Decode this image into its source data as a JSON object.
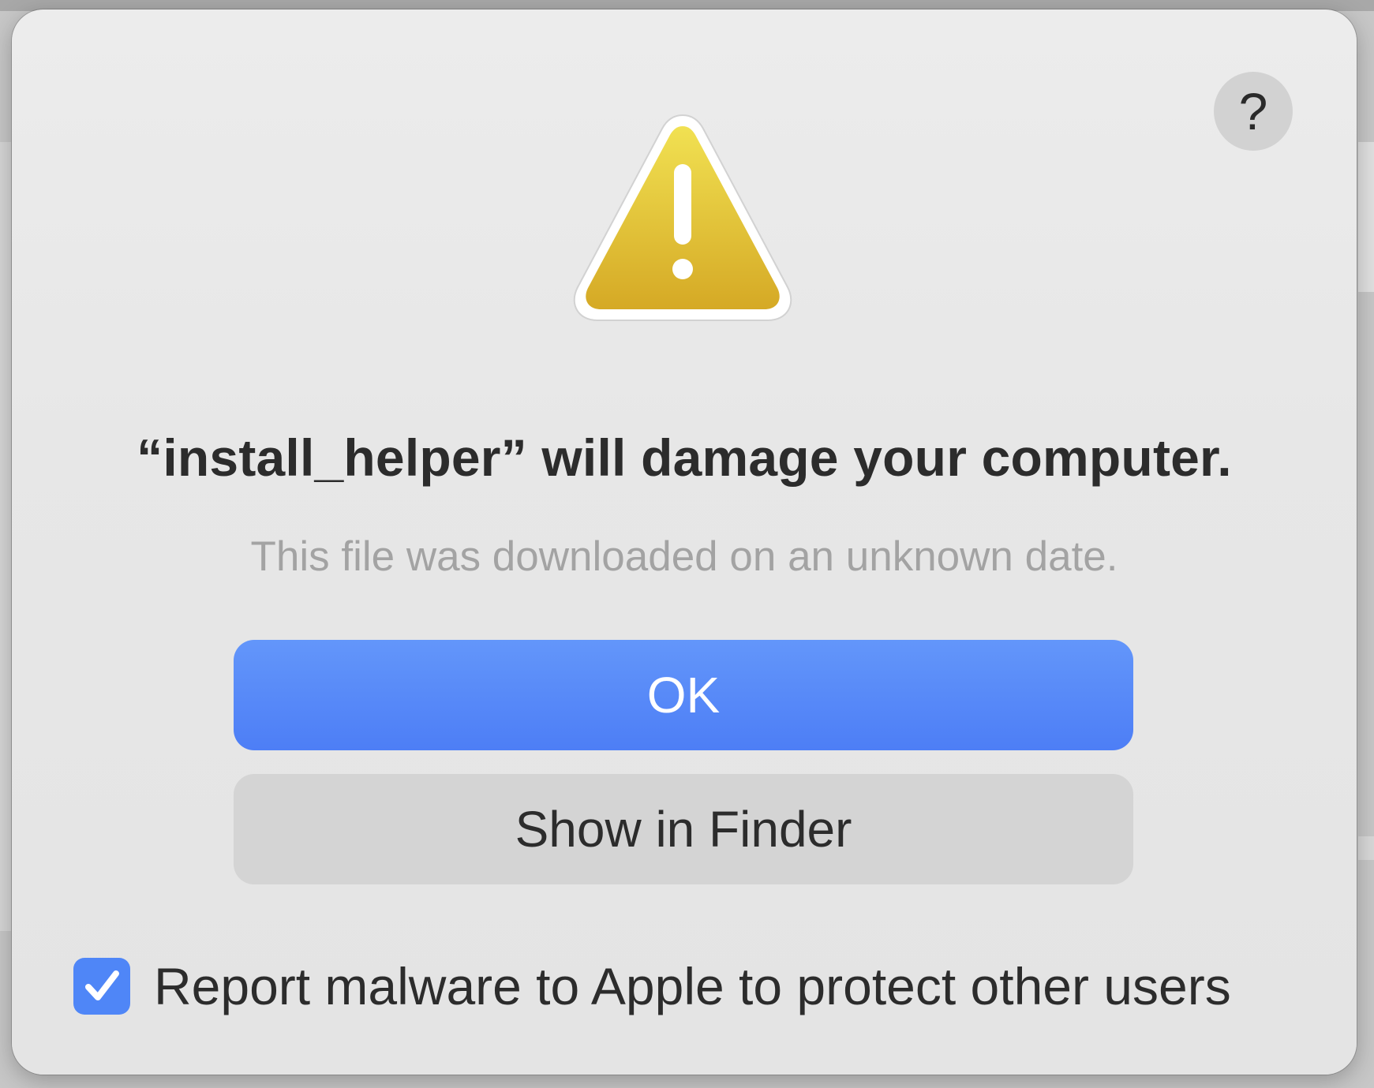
{
  "dialog": {
    "help_label": "?",
    "icon": "warning-triangle-icon",
    "title": "“install_helper” will damage your computer.",
    "subtitle": "This file was downloaded on an unknown date.",
    "buttons": {
      "ok_label": "OK",
      "show_in_finder_label": "Show in Finder"
    },
    "report": {
      "checked": true,
      "label": "Report malware to Apple to protect other users"
    }
  },
  "colors": {
    "primary_button": "#5a8cf8",
    "secondary_button": "#d4d4d4",
    "warning_yellow": "#e8c83a",
    "checkbox": "#4f86f7"
  }
}
